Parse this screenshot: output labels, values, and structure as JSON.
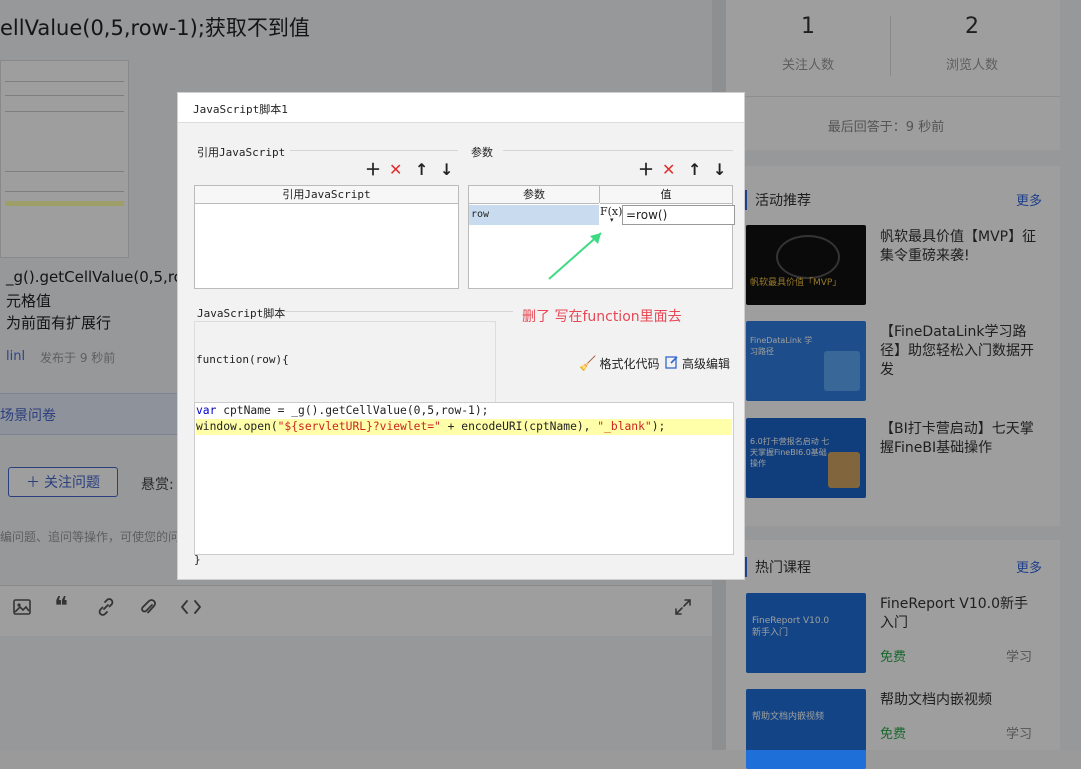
{
  "page": {
    "question_title": "ellValue(0,5,row-1);获取不到值",
    "body_line1": "_g().getCellValue(0,5,ro",
    "body_line2": "元格值",
    "body_line3": "为前面有扩展行",
    "author": "linl",
    "posted": "发布于 9 秒前",
    "survey": "场景问卷",
    "follow_button": "关注问题",
    "reward_label": "悬赏:",
    "hint": "编问题、追问等操作，可使您的问"
  },
  "stats": [
    {
      "value": "1",
      "label": "关注人数"
    },
    {
      "value": "2",
      "label": "浏览人数"
    }
  ],
  "last_answer": "最后回答于：9 秒前",
  "activities": {
    "title": "活动推荐",
    "more": "更多",
    "items": [
      {
        "text": "帆软最具价值【MVP】征集令重磅来袭!",
        "img_text": "帆软最具价值「MVP」"
      },
      {
        "text": "【FineDataLink学习路径】助您轻松入门数据开发",
        "img_text": "FineDataLink 学习路径"
      },
      {
        "text": "【BI打卡营启动】七天掌握FineBI基础操作",
        "img_text": "6.0打卡营报名启动 七天掌握FineBI6.0基础操作"
      }
    ]
  },
  "courses": {
    "title": "热门课程",
    "more": "更多",
    "items": [
      {
        "text": "FineReport V10.0新手入门",
        "price": "免费",
        "action": "学习",
        "img_text": "FineReport V10.0 新手入门"
      },
      {
        "text": "帮助文档内嵌视频",
        "price": "免费",
        "action": "学习",
        "img_text": "帮助文档内嵌视频"
      }
    ]
  },
  "dialog": {
    "title": "JavaScript脚本1",
    "ref_group": "引用JavaScript",
    "ref_header": "引用JavaScript",
    "param_group": "参数",
    "param_header": "参数",
    "value_header": "值",
    "param_name": "row",
    "fx_label": "F(x)",
    "param_value": "=row()",
    "script_group": "JavaScript脚本",
    "function_sig": "function(row){",
    "format_button": "格式化代码",
    "advanced_button": "高级编辑",
    "code": {
      "l1_kw": "var",
      "l1_rest": " cptName = _g().getCellValue(0,5,row-1);",
      "l2_a": "window.open(",
      "l2_s1": "\"${servletURL}?viewlet=\"",
      "l2_b": " + encodeURI(cptName), ",
      "l2_s2": "\"_blank\"",
      "l2_c": ");"
    },
    "close_brace": "}"
  },
  "annotation": "删了 写在function里面去",
  "colors": {
    "accent": "#3366dd",
    "annotation": "#e84855",
    "arrow": "#3ddc84"
  }
}
